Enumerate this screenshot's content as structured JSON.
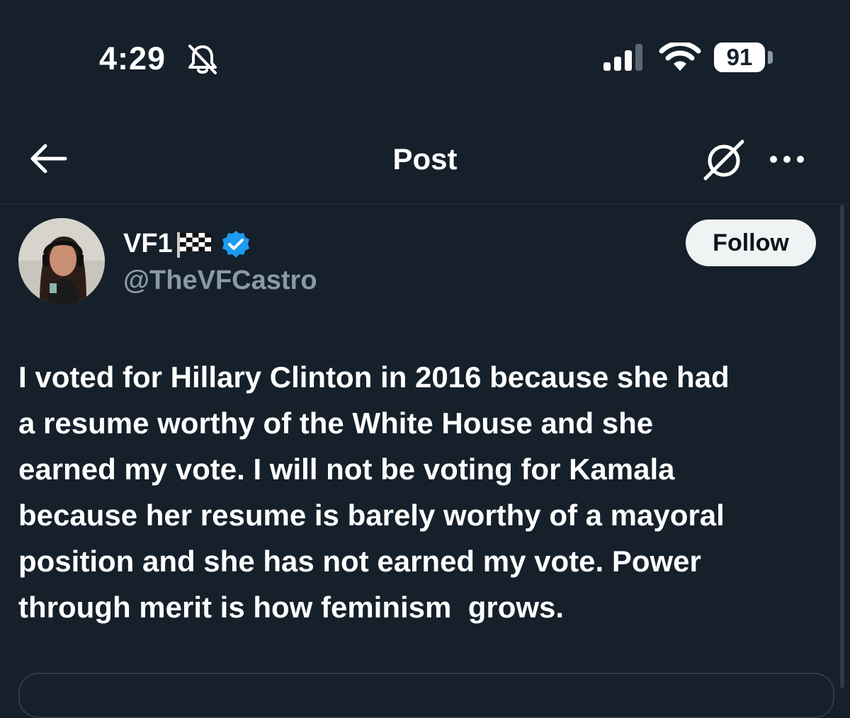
{
  "status_bar": {
    "time": "4:29",
    "battery_level": "91",
    "icons": [
      "bell-slash-icon",
      "cellular-signal-icon",
      "wifi-icon",
      "battery-icon"
    ]
  },
  "nav": {
    "title": "Post",
    "icons": [
      "back-arrow-icon",
      "grok-icon",
      "more-icon"
    ]
  },
  "post": {
    "author": {
      "display_name": "VF1",
      "name_emoji": "chequered-flag-icon",
      "verified": true,
      "handle": "@TheVFCastro"
    },
    "follow_label": "Follow",
    "text": "I voted for Hillary Clinton in 2016 because she had\na resume worthy of the White House and she\nearned my vote. I will not be voting for Kamala\nbecause her resume is barely worthy of a mayoral\nposition and she has not earned my vote. Power\nthrough merit is how feminism  grows."
  },
  "colors": {
    "background": "#15202b",
    "text_primary": "#ffffff",
    "text_secondary": "#8b98a5",
    "verified_blue": "#1d9bf0",
    "follow_button_bg": "#eff3f4"
  }
}
